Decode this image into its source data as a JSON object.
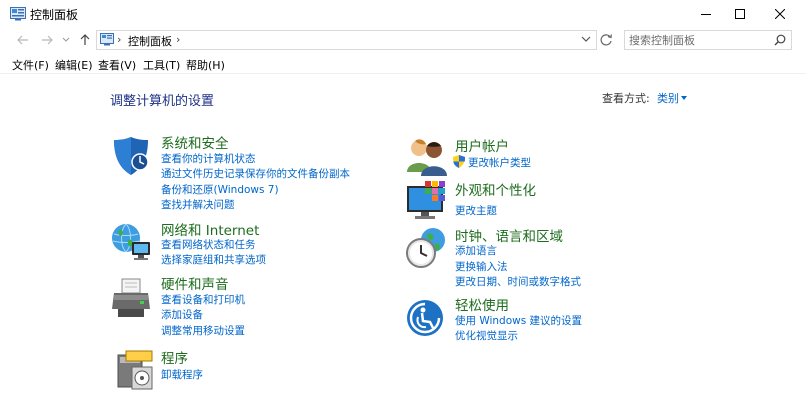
{
  "window": {
    "title": "控制面板"
  },
  "address": {
    "crumb": "控制面板",
    "sep": "›"
  },
  "search": {
    "placeholder": "搜索控制面板"
  },
  "menu": [
    "文件(F)",
    "编辑(E)",
    "查看(V)",
    "工具(T)",
    "帮助(H)"
  ],
  "page": {
    "title": "调整计算机的设置",
    "view_by_label": "查看方式:",
    "view_by_value": "类别"
  },
  "categories": [
    {
      "title": "系统和安全",
      "icon": "shield-icon",
      "links": [
        "查看你的计算机状态",
        "通过文件历史记录保存你的文件备份副本",
        "备份和还原(Windows 7)",
        "查找并解决问题"
      ]
    },
    {
      "title": "网络和 Internet",
      "icon": "globe-network-icon",
      "links": [
        "查看网络状态和任务",
        "选择家庭组和共享选项"
      ]
    },
    {
      "title": "硬件和声音",
      "icon": "printer-icon",
      "links": [
        "查看设备和打印机",
        "添加设备",
        "调整常用移动设置"
      ]
    },
    {
      "title": "程序",
      "icon": "programs-icon",
      "links": [
        "卸载程序"
      ]
    },
    {
      "title": "用户帐户",
      "icon": "users-icon",
      "links": [
        "更改帐户类型"
      ]
    },
    {
      "title": "外观和个性化",
      "icon": "monitor-palette-icon",
      "links": [
        "更改主题"
      ]
    },
    {
      "title": "时钟、语言和区域",
      "icon": "clock-globe-icon",
      "links": [
        "添加语言",
        "更换输入法",
        "更改日期、时间或数字格式"
      ]
    },
    {
      "title": "轻松使用",
      "icon": "ease-of-access-icon",
      "links": [
        "使用 Windows 建议的设置",
        "优化视觉显示"
      ]
    }
  ],
  "colors": {
    "accent_link": "#0066cc",
    "category_title": "#1e6c1e",
    "page_title": "#1e3287"
  }
}
